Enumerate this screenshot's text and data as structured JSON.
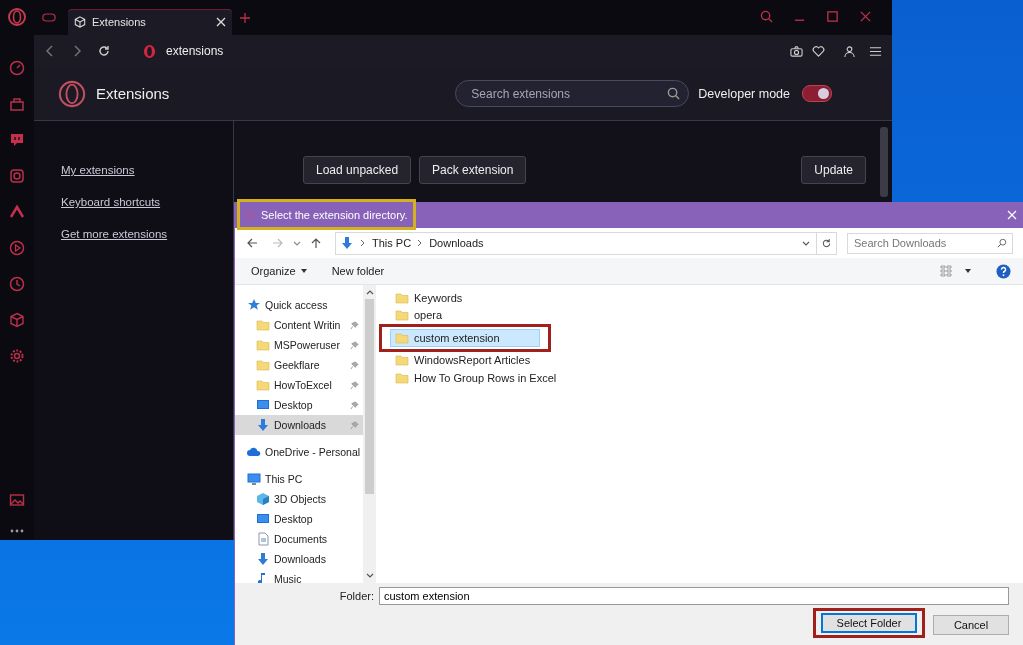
{
  "browser": {
    "tabs": [
      {
        "label": "Extensions",
        "selected": true
      }
    ],
    "address": "extensions",
    "page_title": "Extensions",
    "search": {
      "placeholder": "Search extensions"
    },
    "developer_mode": {
      "label": "Developer mode",
      "on": true
    },
    "nav": [
      {
        "label": "My extensions"
      },
      {
        "label": "Keyboard shortcuts"
      },
      {
        "label": "Get more extensions"
      }
    ],
    "buttons": [
      "Load unpacked",
      "Pack extension"
    ],
    "update_button": "Update"
  },
  "dialog": {
    "title": "Select the extension directory.",
    "highlighted": true,
    "breadcrumb": [
      "This PC",
      "Downloads"
    ],
    "search": {
      "placeholder": "Search Downloads"
    },
    "toolbar": [
      {
        "label": "Organize",
        "dropdown": true
      },
      {
        "label": "New folder",
        "dropdown": false
      }
    ],
    "nav": [
      {
        "label": "Quick access",
        "kind": "star",
        "selected": false,
        "pinned": false,
        "children": [
          {
            "label": "Content Writin",
            "kind": "folder",
            "selected": false,
            "pinned": true
          },
          {
            "label": "MSPoweruser",
            "kind": "folder",
            "selected": false,
            "pinned": true
          },
          {
            "label": "Geekflare",
            "kind": "folder",
            "selected": false,
            "pinned": true
          },
          {
            "label": "HowToExcel",
            "kind": "folder",
            "selected": false,
            "pinned": true
          },
          {
            "label": "Desktop",
            "kind": "desktop",
            "selected": false,
            "pinned": true
          },
          {
            "label": "Downloads",
            "kind": "download",
            "selected": true,
            "pinned": true
          }
        ]
      },
      {
        "label": "OneDrive - Personal",
        "kind": "cloud",
        "selected": false,
        "pinned": false
      },
      {
        "label": "This PC",
        "kind": "pc",
        "selected": false,
        "pinned": false,
        "children": [
          {
            "label": "3D Objects",
            "kind": "cube",
            "selected": false,
            "pinned": false
          },
          {
            "label": "Desktop",
            "kind": "desktop",
            "selected": false,
            "pinned": false
          },
          {
            "label": "Documents",
            "kind": "document",
            "selected": false,
            "pinned": false
          },
          {
            "label": "Downloads",
            "kind": "download",
            "selected": false,
            "pinned": false
          },
          {
            "label": "Music",
            "kind": "music",
            "selected": false,
            "pinned": false
          }
        ]
      }
    ],
    "files": [
      {
        "name": "Keywords",
        "selected": false,
        "highlighted": false
      },
      {
        "name": "opera",
        "selected": false,
        "highlighted": false
      },
      {
        "name": "custom extension",
        "selected": true,
        "highlighted": true
      },
      {
        "name": "WindowsReport Articles",
        "selected": false,
        "highlighted": false
      },
      {
        "name": "How To Group Rows in Excel",
        "selected": false,
        "highlighted": false
      }
    ],
    "folder_label": "Folder:",
    "folder_value": "custom extension",
    "buttons": [
      {
        "label": "Select Folder",
        "highlighted": true
      },
      {
        "label": "Cancel",
        "highlighted": false
      }
    ]
  }
}
